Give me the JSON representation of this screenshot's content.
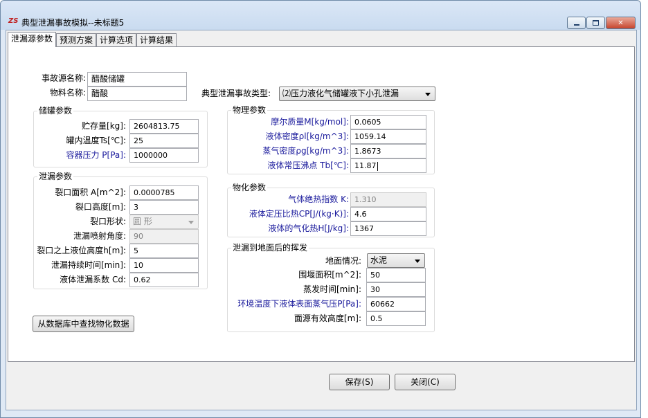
{
  "window": {
    "title": "典型泄漏事故模拟--未标题5",
    "icon": "app-logo-icon",
    "controls": {
      "minimize": "minimize-icon",
      "maximize": "maximize-icon",
      "close": "close-icon"
    }
  },
  "tabs": [
    "泄漏源参数",
    "预测方案",
    "计算选项",
    "计算结果"
  ],
  "source": {
    "name_label": "事故源名称:",
    "name_value": "醋酸储罐",
    "material_label": "物料名称:",
    "material_value": "醋酸",
    "accident_type_label": "典型泄漏事故类型:",
    "accident_type_value": "⑵压力液化气储罐液下小孔泄漏"
  },
  "storage": {
    "title": "储罐参数",
    "fields": [
      {
        "label": "贮存量[kg]:",
        "value": "2604813.75"
      },
      {
        "label": "罐内温度Ts[℃]:",
        "value": "25"
      },
      {
        "label": "容器压力 P[Pa]:",
        "value": "1000000"
      }
    ]
  },
  "leak": {
    "title": "泄漏参数",
    "fields": [
      {
        "label": "裂口面积 A[m^2]:",
        "value": "0.0000785"
      },
      {
        "label": "裂口高度[m]:",
        "value": "3"
      },
      {
        "label": "裂口形状:",
        "value": "圆  形"
      },
      {
        "label": "泄漏喷射角度:",
        "value": "90"
      },
      {
        "label": "裂口之上液位高度h[m]:",
        "value": "5"
      },
      {
        "label": "泄漏持续时间[min]:",
        "value": "10"
      },
      {
        "label": "液体泄漏系数  Cd:",
        "value": "0.62"
      }
    ]
  },
  "physical": {
    "title": "物理参数",
    "fields": [
      {
        "label": "摩尔质量M[kg/mol]:",
        "value": "0.0605"
      },
      {
        "label": "液体密度ρl[kg/m^3]:",
        "value": "1059.14"
      },
      {
        "label": "蒸气密度ρg[kg/m^3]:",
        "value": "1.8673"
      },
      {
        "label": "液体常压沸点 Tb[℃]:",
        "value": "11.87"
      }
    ]
  },
  "physchem": {
    "title": "物化参数",
    "fields": [
      {
        "label": "气体绝热指数  K:",
        "value": "1.310"
      },
      {
        "label": "液体定压比热CP[J/(kg·K)]:",
        "value": "4.6"
      },
      {
        "label": "液体的气化热H[J/kg]:",
        "value": "1367"
      }
    ]
  },
  "evaporation": {
    "title": "泄漏到地面后的挥发",
    "fields": [
      {
        "label": "地面情况:",
        "value": "水泥"
      },
      {
        "label": "围堰面积[m^2]:",
        "value": "50"
      },
      {
        "label": "蒸发时间[min]:",
        "value": "30"
      },
      {
        "label": "环境温度下液体表面蒸气压P[Pa]:",
        "value": "60662"
      },
      {
        "label": "面源有效高度[m]:",
        "value": "0.5"
      }
    ]
  },
  "buttons": {
    "lookup": "从数据库中查找物化数据",
    "save": "保存(S)",
    "close": "关闭(C)"
  }
}
